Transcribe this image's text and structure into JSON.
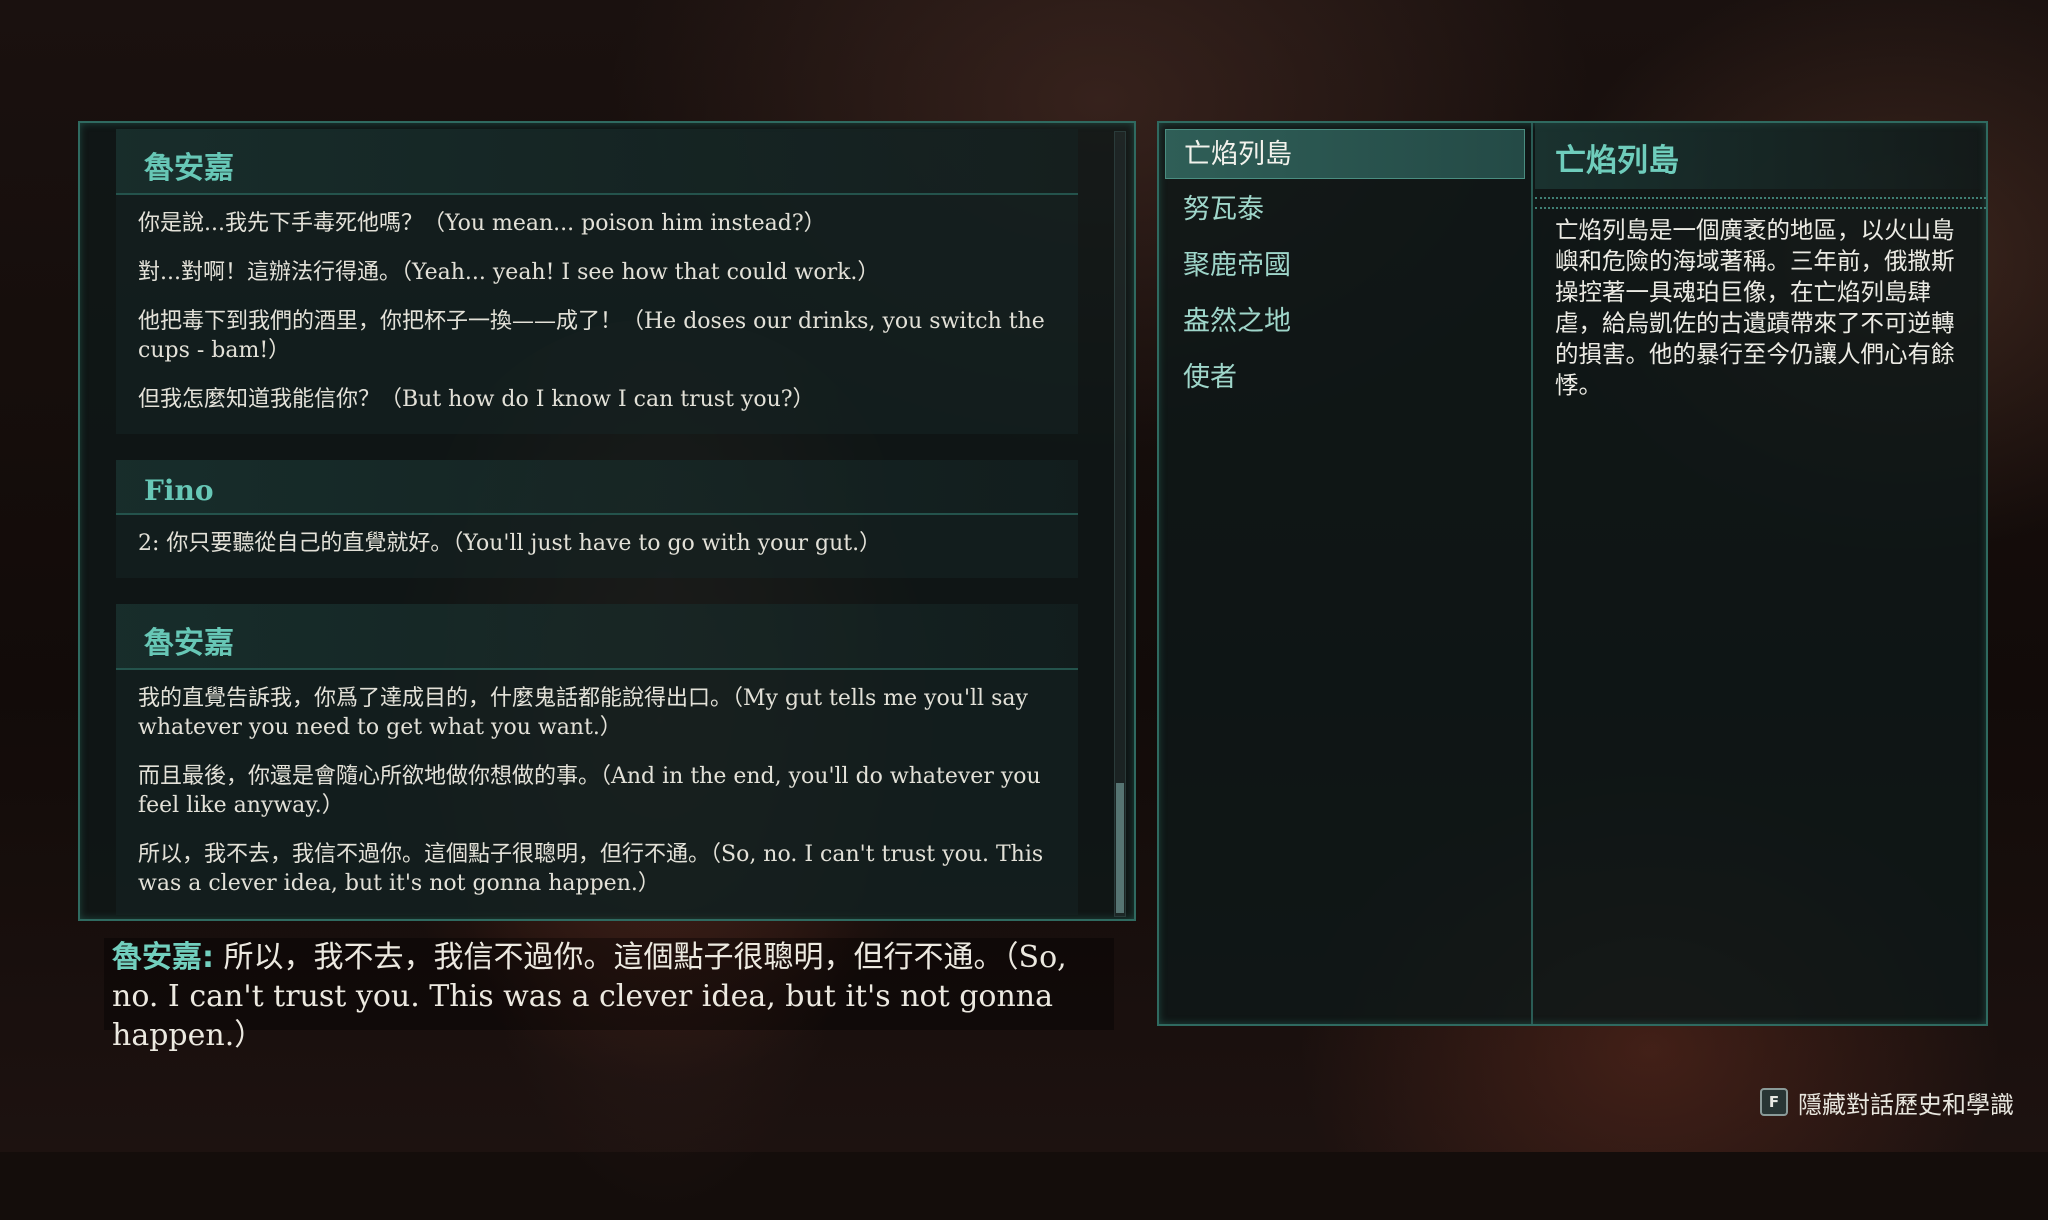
{
  "dialogue_history": [
    {
      "speaker": "魯安嘉",
      "lines": [
        "你是說...我先下手毒死他嗎？（You mean... poison him instead?）",
        "對...對啊！這辦法行得通。（Yeah... yeah! I see how that could work.）",
        "他把毒下到我們的酒里，你把杯子一換——成了！（He doses our drinks, you switch the cups - bam!）",
        "但我怎麼知道我能信你？（But how do I know I can trust you?）"
      ]
    },
    {
      "speaker": "Fino",
      "lines": [
        "2: 你只要聽從自己的直覺就好。（You'll just have to go with your gut.）"
      ]
    },
    {
      "speaker": "魯安嘉",
      "lines": [
        "我的直覺告訴我，你爲了達成目的，什麼鬼話都能說得出口。（My gut tells me you'll say whatever you need to get what you want.）",
        "而且最後，你還是會隨心所欲地做你想做的事。（And in the end, you'll do whatever you feel like anyway.）",
        "所以，我不去，我信不過你。這個點子很聰明，但行不通。（So, no. I can't trust you. This was a clever idea, but it's not gonna happen.）"
      ]
    }
  ],
  "scroll_position": 1.0,
  "subtitle": {
    "speaker": "魯安嘉:",
    "text": " 所以，我不去，我信不過你。這個點子很聰明，但行不通。（So, no. I can't trust you. This was a clever idea, but it's not gonna happen.）"
  },
  "lore": {
    "items": [
      {
        "label": "亡焰列島",
        "selected": true
      },
      {
        "label": "努瓦泰",
        "selected": false
      },
      {
        "label": "聚鹿帝國",
        "selected": false
      },
      {
        "label": "盎然之地",
        "selected": false
      },
      {
        "label": "使者",
        "selected": false
      }
    ],
    "detail_title": "亡焰列島",
    "detail_text": "亡焰列島是一個廣袤的地區，以火山島嶼和危險的海域著稱。三年前，俄撒斯操控著一具魂珀巨像，在亡焰列島肆虐，給烏凱佐的古遺蹟帶來了不可逆轉的損害。他的暴行至今仍讓人們心有餘悸。"
  },
  "hint": {
    "key": "F",
    "label": "隱藏對話歷史和學識"
  },
  "colors": {
    "accent": "#67c7b6",
    "panel_border": "#2f6a60",
    "text": "#e3e1d8"
  }
}
